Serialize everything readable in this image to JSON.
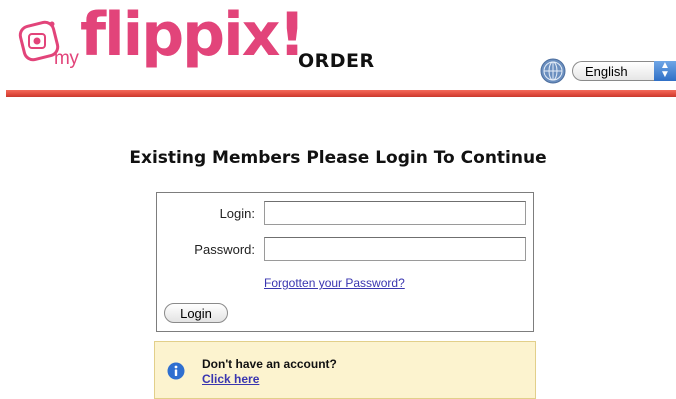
{
  "header": {
    "logo_my": "my",
    "logo_brand": "flippix!",
    "logo_suffix": "ORDER",
    "brand_color": "#e2447a",
    "rule_color": "#e04a3d"
  },
  "language": {
    "icon": "globe-icon",
    "selected": "English"
  },
  "heading": "Existing Members Please Login To Continue",
  "login_form": {
    "login_label": "Login:",
    "login_value": "",
    "password_label": "Password:",
    "password_value": "",
    "forgot_link": "Forgotten your Password?",
    "submit_label": "Login"
  },
  "signup": {
    "icon": "info-icon",
    "text": "Don't have an account?",
    "link": "Click here"
  }
}
